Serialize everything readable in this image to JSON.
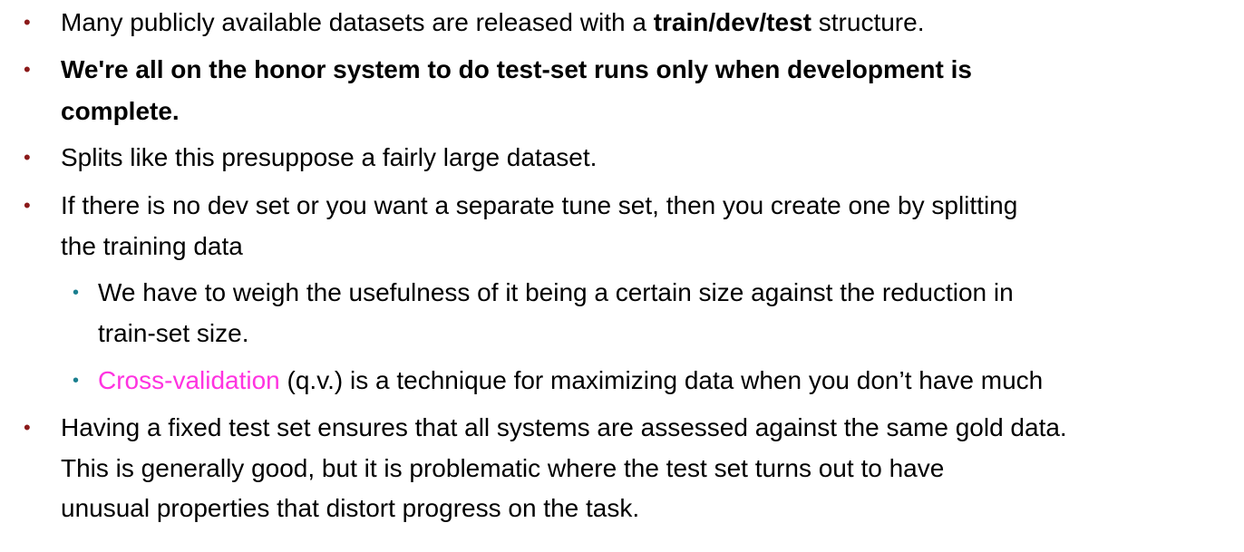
{
  "bullets": [
    {
      "pre": "Many publicly available datasets are released with a ",
      "bold": "train/dev/test",
      "post": " structure."
    },
    {
      "lines": [
        "We're all on the honor system to do test-set runs only when development is",
        "complete."
      ]
    },
    {
      "lines": [
        "Splits like this presuppose a fairly large dataset."
      ]
    },
    {
      "lines": [
        "If there is no dev set or you want a separate tune set, then you create one by splitting",
        "the training data"
      ]
    },
    {
      "lines": [
        "We have to weigh the usefulness of it being a certain size against the reduction in",
        "train-set size."
      ]
    },
    {
      "highlight": "Cross-validation",
      "rest": " (q.v.) is a technique for maximizing data when you don’t have much"
    },
    {
      "lines": [
        "Having a fixed test set ensures that all systems are assessed against the same gold data.",
        "This is generally good, but it is problematic where the test set turns out to have",
        "unusual properties that distort progress on the task."
      ]
    }
  ],
  "colors": {
    "main_bullet": "#8b1a1a",
    "sub_bullet": "#1b7f8f",
    "highlight": "#ff33e0"
  }
}
